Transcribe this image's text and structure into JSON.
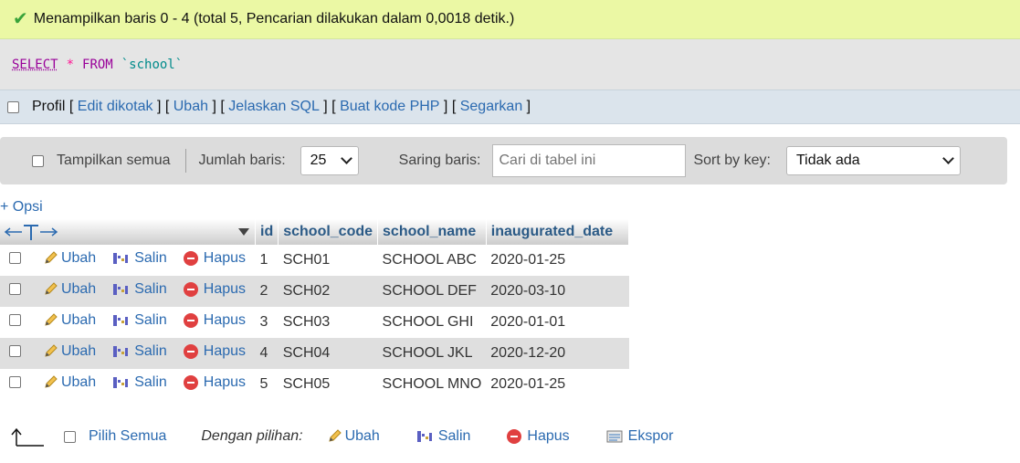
{
  "message": {
    "text": "Menampilkan baris 0 - 4 (total 5, Pencarian dilakukan dalam 0,0018 detik.)",
    "icon": "check-icon"
  },
  "sql": {
    "select": "SELECT",
    "star": "*",
    "from": "FROM",
    "table": "`school`"
  },
  "profile_bar": {
    "profil": "Profil",
    "open": " [ ",
    "edit": "Edit dikotak",
    "mid1": " ] [ ",
    "ubah": "Ubah",
    "mid2": " ] [ ",
    "jelaskan": "Jelaskan SQL",
    "mid3": " ] [ ",
    "buat": "Buat kode PHP",
    "mid4": " ] [ ",
    "segarkan": "Segarkan",
    "close": " ]"
  },
  "toolbar": {
    "show_all": "Tampilkan semua",
    "rows_label": "Jumlah baris:",
    "rows_value": "25",
    "filter_label": "Saring baris:",
    "filter_placeholder": "Cari di tabel ini",
    "sort_label": "Sort by key:",
    "sort_value": "Tidak ada"
  },
  "options_link": "+ Opsi",
  "table": {
    "headers": [
      "id",
      "school_code",
      "school_name",
      "inaugurated_date"
    ],
    "actions": {
      "edit": "Ubah",
      "copy": "Salin",
      "delete": "Hapus"
    },
    "rows": [
      {
        "id": "1",
        "school_code": "SCH01",
        "school_name": "SCHOOL ABC",
        "inaugurated_date": "2020-01-25"
      },
      {
        "id": "2",
        "school_code": "SCH02",
        "school_name": "SCHOOL DEF",
        "inaugurated_date": "2020-03-10"
      },
      {
        "id": "3",
        "school_code": "SCH03",
        "school_name": "SCHOOL GHI",
        "inaugurated_date": "2020-01-01"
      },
      {
        "id": "4",
        "school_code": "SCH04",
        "school_name": "SCHOOL JKL",
        "inaugurated_date": "2020-12-20"
      },
      {
        "id": "5",
        "school_code": "SCH05",
        "school_name": "SCHOOL MNO",
        "inaugurated_date": "2020-01-25"
      }
    ]
  },
  "footer": {
    "select_all": "Pilih Semua",
    "with_selected": "Dengan pilihan:",
    "edit": "Ubah",
    "copy": "Salin",
    "delete": "Hapus",
    "export": "Ekspor"
  }
}
